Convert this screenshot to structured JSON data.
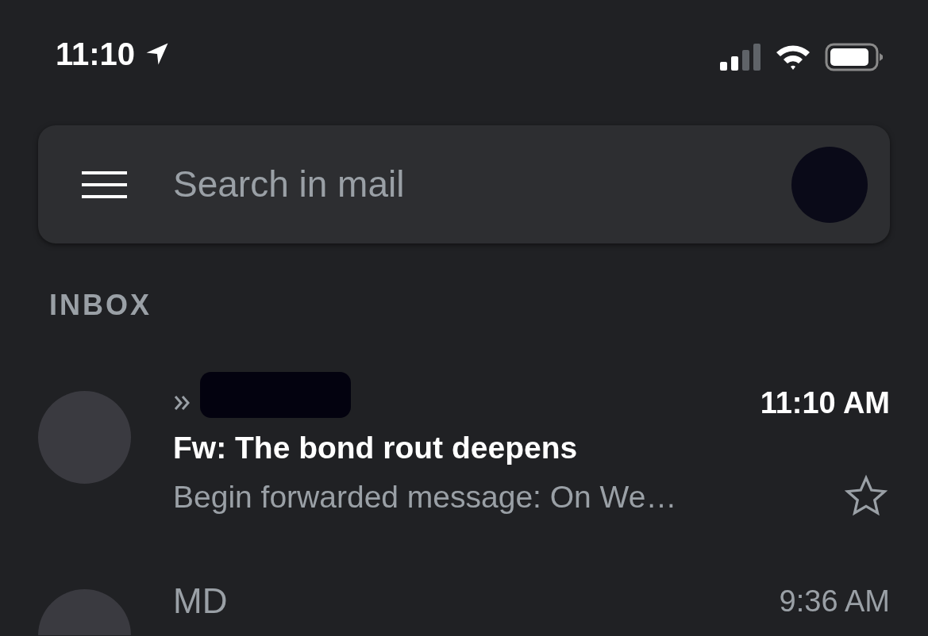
{
  "status_bar": {
    "time": "11:10"
  },
  "search": {
    "placeholder": "Search in mail"
  },
  "section_title": "INBOX",
  "emails": [
    {
      "important": true,
      "sender_redacted": true,
      "time": "11:10 AM",
      "subject": "Fw: The bond rout deepens",
      "snippet": "Begin forwarded message: On We…",
      "unread": true,
      "starred": false
    },
    {
      "sender": "MD",
      "important": false,
      "sender_redacted": false,
      "time": "9:36 AM",
      "unread": false
    }
  ]
}
